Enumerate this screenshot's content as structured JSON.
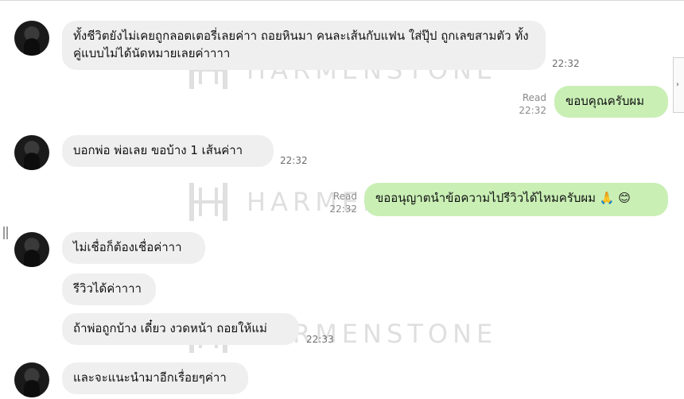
{
  "watermark": {
    "text": "HARMENSTONE"
  },
  "messages": {
    "m1": {
      "text": "ทั้งชีวิตยังไม่เคยถูกลอตเตอรี่เลยค่าา ถอยหินมา  คนละเส้นกับแฟน ใส่ปุ๊ป ถูกเลขสามตัว ทั้งคู่แบบไม่ได้นัดหมายเลยค่าาาา",
      "time": "22:32"
    },
    "m2": {
      "text": "ขอบคุณครับผม",
      "read": "Read",
      "time": "22:32"
    },
    "m3": {
      "text": "บอกพ่อ พ่อเลย ขอบ้าง 1 เส้นค่าา",
      "time": "22:32"
    },
    "m4": {
      "text": "ขออนุญาตนำข้อความไปรีวิวได้ไหมครับผม",
      "emoji1": "🙏",
      "emoji2": "😊",
      "read": "Read",
      "time": "22:32"
    },
    "m5": {
      "text": "ไม่เชื่อก็ต้องเชื่อค่าาา"
    },
    "m6": {
      "text": "รีวิวได้ค่าาาา"
    },
    "m7": {
      "text": "ถ้าพ่อถูกบ้าง เดี๋ยว งวดหน้า ถอยให้แม่",
      "time": "22:33"
    },
    "m8": {
      "text": "และจะแนะนำมาอีกเรื่อยๆค่าา"
    }
  },
  "side_tab": {
    "glyph": "›"
  },
  "icons": {
    "avatar": "user-avatar-photo",
    "drag": "drag-handle-icon"
  }
}
